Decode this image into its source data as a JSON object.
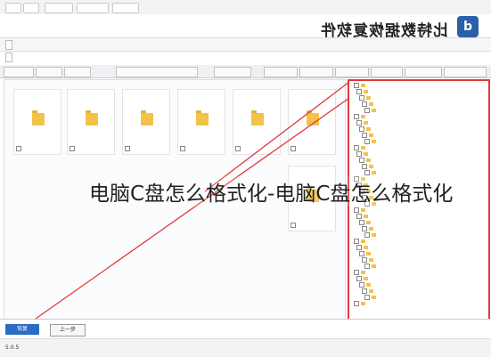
{
  "window": {
    "strip_items": [
      "",
      "",
      "",
      "",
      ""
    ],
    "app_title": "比特数据恢复软件"
  },
  "toolbar": {
    "buttons": [
      "",
      ""
    ]
  },
  "info": {
    "lines": [
      "",
      "",
      ""
    ]
  },
  "tabs": [
    "",
    "",
    "",
    "",
    "",
    "",
    "",
    "",
    "",
    "",
    ""
  ],
  "files": [
    {
      "label": ""
    },
    {
      "label": ""
    },
    {
      "label": ""
    },
    {
      "label": ""
    },
    {
      "label": ""
    },
    {
      "label": ""
    },
    {
      "label": ""
    }
  ],
  "tree": {
    "items": [
      "",
      "",
      "",
      "",
      "",
      "",
      "",
      "",
      "",
      "",
      "",
      "",
      "",
      "",
      "",
      "",
      "",
      "",
      "",
      "",
      "",
      "",
      "",
      "",
      "",
      "",
      "",
      "",
      "",
      "",
      "",
      "",
      "",
      "",
      "",
      ""
    ]
  },
  "footer": {
    "recover_label": "恢复",
    "prev_label": "上一步",
    "version": "5.0.5",
    "support": "",
    "right": ""
  },
  "watermark": "电脑C盘怎么格式化-电脑C盘怎么格式化",
  "colors": {
    "accent": "#2a6cc4",
    "highlight": "#e03a3a",
    "folder": "#f3c248"
  }
}
